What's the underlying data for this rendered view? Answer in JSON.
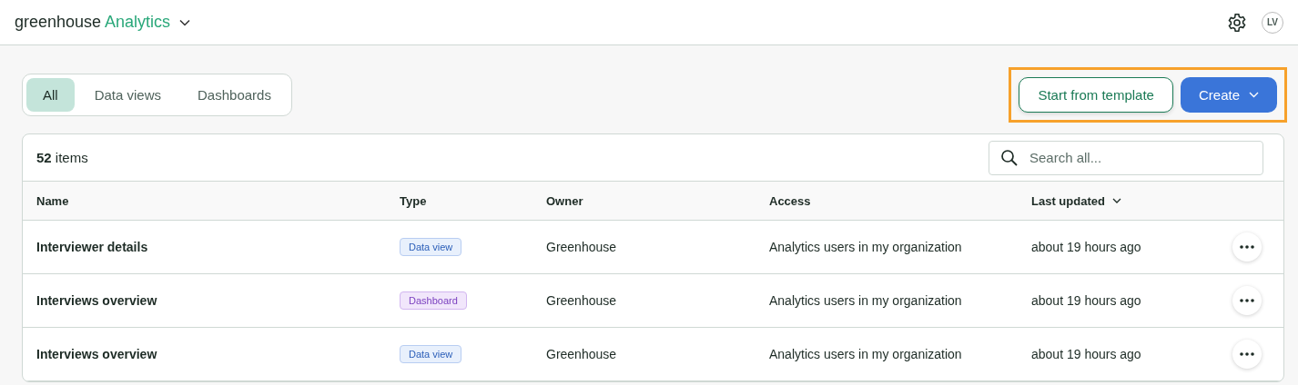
{
  "header": {
    "brand": "greenhouse",
    "product": "Analytics",
    "avatar": "LV"
  },
  "tabs": [
    {
      "label": "All",
      "selected": true
    },
    {
      "label": "Data views",
      "selected": false
    },
    {
      "label": "Dashboards",
      "selected": false
    }
  ],
  "actions": {
    "highlighted": true,
    "secondary": "Start from template",
    "primary": "Create"
  },
  "table": {
    "count": "**52** items",
    "search": {
      "placeholder": "Search all..."
    },
    "columns": [
      {
        "label": "Name",
        "sorted": false
      },
      {
        "label": "Type",
        "sorted": false
      },
      {
        "label": "Owner",
        "sorted": false
      },
      {
        "label": "Access",
        "sorted": false
      },
      {
        "label": "Last updated",
        "sorted": true
      }
    ],
    "rows": [
      {
        "name": "Interviewer details",
        "type": {
          "kind": "data_view",
          "label": "Data view"
        },
        "owner": "Greenhouse",
        "access": "Analytics users in my organization",
        "updated": "about 19 hours ago"
      },
      {
        "name": "Interviews overview",
        "type": {
          "kind": "dashboard",
          "label": "Dashboard"
        },
        "owner": "Greenhouse",
        "access": "Analytics users in my organization",
        "updated": "about 19 hours ago"
      },
      {
        "name": "Interviews overview",
        "type": {
          "kind": "data_view",
          "label": "Data view"
        },
        "owner": "Greenhouse",
        "access": "Analytics users in my organization",
        "updated": "about 19 hours ago"
      }
    ]
  }
}
